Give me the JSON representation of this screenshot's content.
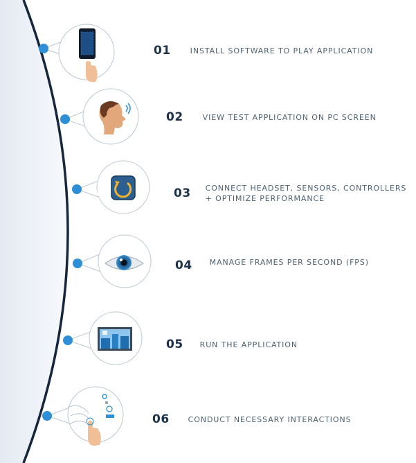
{
  "steps": [
    {
      "number": "01",
      "text": "INSTALL SOFTWARE TO PLAY APPLICATION",
      "text2": "",
      "icon": "smartphone-touch-icon"
    },
    {
      "number": "02",
      "text": "VIEW TEST APPLICATION ON PC SCREEN",
      "text2": "",
      "icon": "head-profile-icon"
    },
    {
      "number": "03",
      "text": "CONNECT HEADSET, SENSORS, CONTROLLERS",
      "text2": "+ OPTIMIZE PERFORMANCE",
      "icon": "refresh-app-icon"
    },
    {
      "number": "04",
      "text": "MANAGE FRAMES PER SECOND (FPS)",
      "text2": "",
      "icon": "eye-icon"
    },
    {
      "number": "05",
      "text": "RUN THE APPLICATION",
      "text2": "",
      "icon": "desktop-monitor-icon"
    },
    {
      "number": "06",
      "text": "CONDUCT NECESSARY INTERACTIONS",
      "text2": "",
      "icon": "hand-interaction-icon"
    }
  ],
  "colors": {
    "arc": "#15263d",
    "dot": "#2e8fd6",
    "number": "#1d3248",
    "text": "#4f6170",
    "shade": "#e9eef6"
  }
}
